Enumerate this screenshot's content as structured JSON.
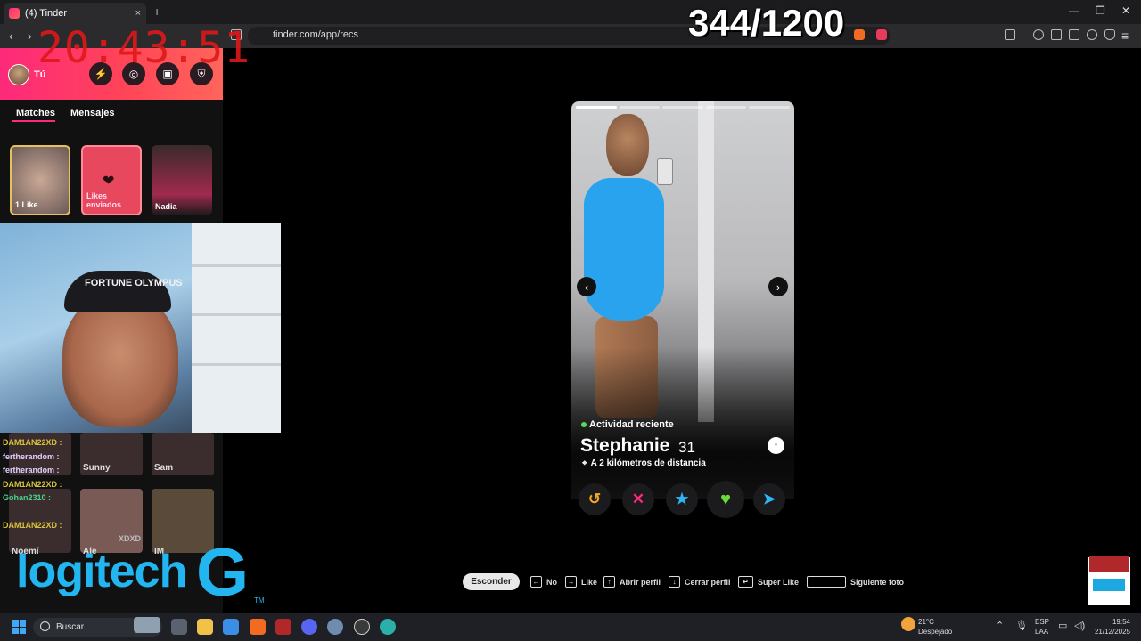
{
  "browser": {
    "tab_title": "(4) Tinder",
    "tab_close": "×",
    "new_tab": "+",
    "url": "tinder.com/app/recs",
    "back": "‹",
    "forward": "›"
  },
  "overlay": {
    "clock": "20:43:51",
    "counter": "344/1200"
  },
  "sidebar": {
    "user_label": "Tú",
    "tabs": [
      "Matches",
      "Mensajes"
    ],
    "matches": [
      {
        "label": "1 Like"
      },
      {
        "label": "Likes enviados"
      },
      {
        "label": "Nadia"
      }
    ],
    "cap_text": "FORTUNE OLYMPUS",
    "chat": [
      {
        "user": "DAM1AN22XD",
        "text": ":"
      },
      {
        "user": "fertherandom",
        "text": ":"
      },
      {
        "user": "fertherandom",
        "text": ":"
      },
      {
        "user": "DAM1AN22XD",
        "text": ":"
      },
      {
        "user": "Gohan2310",
        "text": ":"
      },
      {
        "user": "DAM1AN22XD",
        "text": ":"
      },
      {
        "user": "XDXD",
        "text": ""
      }
    ],
    "thumbs": [
      "Sunny",
      "Sam",
      "Noemí",
      "Ale",
      "IM"
    ],
    "brand_logo": "logitech",
    "brand_g": "G",
    "brand_tm": "TM"
  },
  "profile": {
    "activity": "Actividad reciente",
    "name": "Stephanie",
    "age": "31",
    "distance": "A 2 kilómetros de distancia",
    "photo_count": 5,
    "active_photo": 1
  },
  "actions": [
    {
      "name": "rewind",
      "glyph": "↺",
      "color": "#f5a623"
    },
    {
      "name": "nope",
      "glyph": "✕",
      "color": "#fd297b"
    },
    {
      "name": "super-like",
      "glyph": "★",
      "color": "#2db5f5"
    },
    {
      "name": "like",
      "glyph": "♥",
      "color": "#6ddc3a"
    },
    {
      "name": "boost",
      "glyph": "➤",
      "color": "#2db5f5"
    }
  ],
  "hints": {
    "hide": "Esconder",
    "no": "No",
    "like": "Like",
    "open_profile": "Abrir perfil",
    "close_profile": "Cerrar perfil",
    "super_like": "Super Like",
    "next_photo": "Siguiente foto"
  },
  "taskbar": {
    "search": "Buscar",
    "temp": "21°C",
    "weather": "Despejado",
    "lang": "ESP",
    "lang2": "LAA",
    "time": "19:54",
    "date": "21/12/2025"
  }
}
